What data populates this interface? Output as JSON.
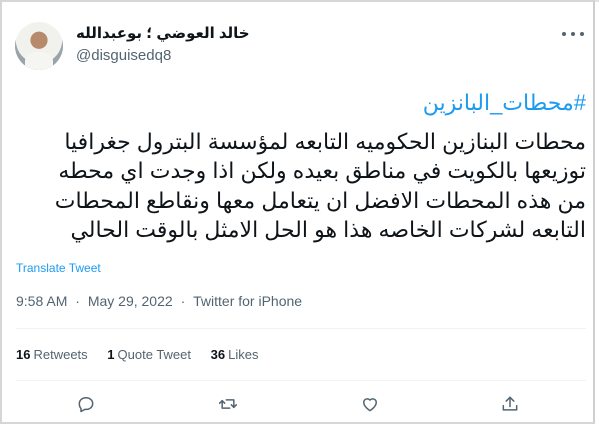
{
  "author": {
    "display_name": "خالد العوضي ؛ بوعبدالله",
    "handle": "@disguisedq8"
  },
  "tweet": {
    "hashtag": "#محطات_البانزين",
    "lines": [
      "محطات البنازين الحكوميه التابعه لمؤسسة البترول جغرافيا",
      "توزيعها بالكويت في مناطق بعيده ولكن اذا وجدت اي محطه",
      "من هذه المحطات الافضل ان يتعامل معها ونقاطع المحطات",
      "التابعه لشركات الخاصه هذا هو الحل الامثل بالوقت الحالي"
    ],
    "translate_label": "Translate Tweet",
    "time": "9:58 AM",
    "date": "May 29, 2022",
    "source": "Twitter for iPhone",
    "separator": "·"
  },
  "stats": {
    "retweets_count": "16",
    "retweets_label": "Retweets",
    "quotes_count": "1",
    "quotes_label": "Quote Tweet",
    "likes_count": "36",
    "likes_label": "Likes"
  },
  "icons": {
    "more": "more-horizontal-icon",
    "reply": "reply-icon",
    "retweet": "retweet-icon",
    "like": "heart-icon",
    "share": "share-icon"
  },
  "colors": {
    "accent": "#1d9bf0",
    "text": "#0f1419",
    "muted": "#536471"
  }
}
